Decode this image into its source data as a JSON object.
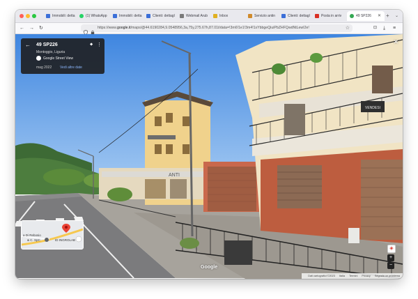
{
  "tabs": [
    {
      "label": "Immobili: detta",
      "color": "#3b6fd8"
    },
    {
      "label": "(1) WhatsApp",
      "color": "#25d366"
    },
    {
      "label": "Immobili: detta",
      "color": "#3b6fd8"
    },
    {
      "label": "Clienti: dettagl",
      "color": "#3b6fd8"
    },
    {
      "label": "Webmail Arub",
      "color": "#7a7a7a"
    },
    {
      "label": "Inbox",
      "color": "#e0b020"
    },
    {
      "label": "Servizio antin",
      "color": "#d08a2c"
    },
    {
      "label": "Clienti: dettagl",
      "color": "#3b6fd8"
    },
    {
      "label": "Posta in arriv",
      "color": "#d93025"
    },
    {
      "label": "49 SP226",
      "color": "#34a853"
    }
  ],
  "toolbar": {
    "back_icon": "←",
    "forward_icon": "→",
    "reload_icon": "↻",
    "url_prefix": "https://www.",
    "url_domain": "google.it",
    "url_rest": "/maps/@44.6190284,9.0548956,3a,75y,275.67h,87.01t/data=!3m6!1e1!3m4!1sYbbgeQiuiPbZHFQwdNtLewI2e!"
  },
  "street_view": {
    "title": "49 SP226",
    "subtitle": "Montoggio, Liguria",
    "provider": "Google Street View",
    "date": "mag 2022",
    "more_dates": "Vedi altre date",
    "store_sign": "ANTI",
    "balcony_sign": "VENDESI",
    "google_logo": "Google",
    "attribution": "Dati cartografici ©2023",
    "attribution_2": "Italia",
    "attribution_3": "Termini",
    "attribution_4": "Privacy",
    "attribution_5": "Segnala un problema"
  },
  "minimap": {
    "label1": "a Di Rebosio",
    "label2": "& C. SpC",
    "label3": "ID INGROLAB",
    "road_color": "#f6c84f",
    "pin_color": "#ea4335"
  }
}
